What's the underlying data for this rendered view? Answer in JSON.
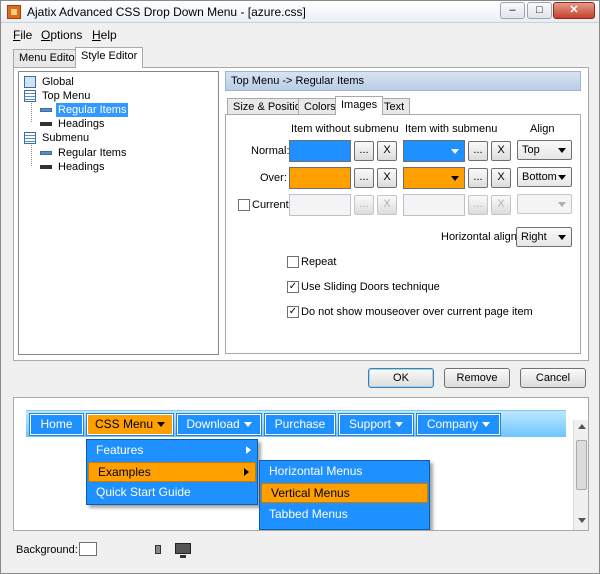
{
  "window": {
    "title": "Ajatix Advanced CSS Drop Down Menu - [azure.css]",
    "min_glyph": "–",
    "max_glyph": "□",
    "close_glyph": "✕"
  },
  "menubar": [
    {
      "underline": "F",
      "rest": "ile"
    },
    {
      "underline": "O",
      "rest": "ptions"
    },
    {
      "underline": "H",
      "rest": "elp"
    }
  ],
  "outer_tabs": [
    "Menu Editor",
    "Style Editor"
  ],
  "tree": {
    "global": "Global",
    "top_menu": "Top Menu",
    "top_regular": "Regular Items",
    "top_headings": "Headings",
    "submenu": "Submenu",
    "sub_regular": "Regular Items",
    "sub_headings": "Headings"
  },
  "right_header": "Top Menu -> Regular Items",
  "inner_tabs": [
    "Size & Position",
    "Colors",
    "Images",
    "Text"
  ],
  "images": {
    "col_without": "Item without submenu",
    "col_with": "Item with submenu",
    "col_align": "Align",
    "row_normal": "Normal:",
    "row_over": "Over:",
    "row_current": "Current",
    "normal_align": "Top",
    "over_align": "Bottom",
    "current_align": "",
    "ellipsis": "...",
    "clear": "X",
    "horizontal_align_label": "Horizontal align:",
    "horizontal_align": "Right",
    "repeat": "Repeat",
    "sliding": "Use Sliding Doors technique",
    "no_mouseover": "Do not show mouseover over current page item",
    "repeat_checked": false,
    "sliding_checked": true,
    "no_mouseover_checked": true,
    "current_checked": false,
    "check_glyph": "✓"
  },
  "buttons": {
    "ok": "OK",
    "remove": "Remove",
    "cancel": "Cancel"
  },
  "preview": {
    "menu": [
      "Home",
      "CSS Menu",
      "Download",
      "Purchase",
      "Support",
      "Company"
    ],
    "submenu": [
      "Features",
      "Examples",
      "Quick Start Guide"
    ],
    "subsubmenu": [
      "Horizontal Menus",
      "Vertical Menus",
      "Tabbed Menus"
    ],
    "colors": {
      "normal": "#1e90ff",
      "over": "#ffa000"
    }
  },
  "footer": {
    "background_label": "Background:"
  }
}
